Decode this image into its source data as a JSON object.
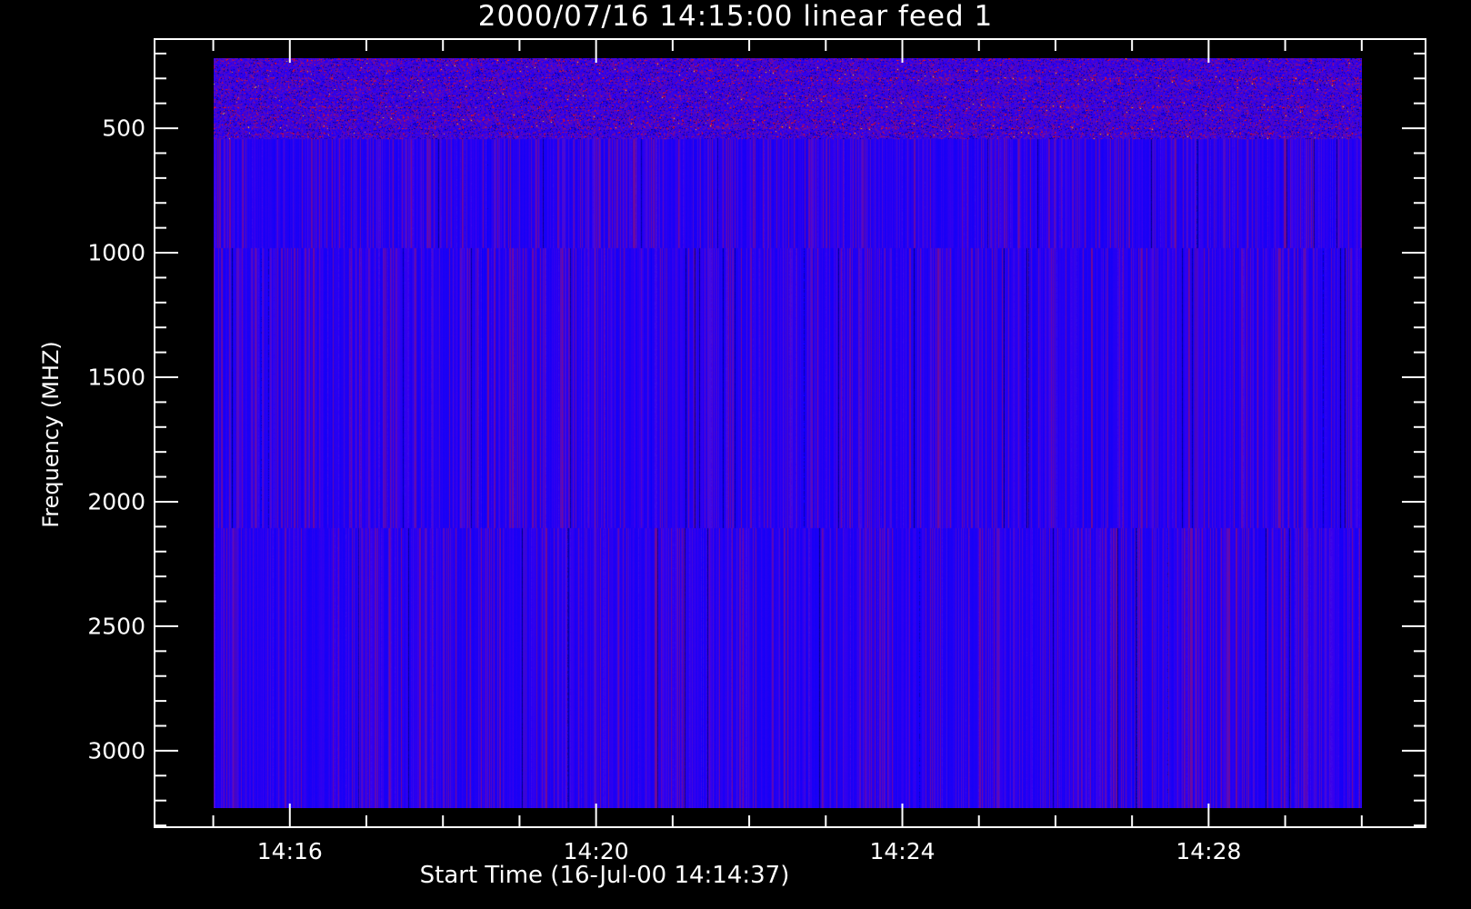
{
  "chart_data": {
    "type": "heatmap",
    "title": "2000/07/16 14:15:00 linear feed 1",
    "xlabel": "Start Time (16-Jul-00 14:14:37)",
    "ylabel": "Frequency (MHZ)",
    "x_unit": "minutes",
    "xlim": [
      "14:14:14",
      "14:30:50"
    ],
    "data_x_range": [
      "14:15:00",
      "14:30:00"
    ],
    "x_major_ticks": [
      {
        "minute": 16,
        "label": "14:16"
      },
      {
        "minute": 20,
        "label": "14:20"
      },
      {
        "minute": 24,
        "label": "14:24"
      },
      {
        "minute": 28,
        "label": "14:28"
      }
    ],
    "x_minor_tick_interval_min": 1,
    "ylim": [
      142,
      3307
    ],
    "y_inverted": true,
    "data_y_range": [
      220,
      3230
    ],
    "y_major_ticks": [
      {
        "value": 500,
        "label": "500"
      },
      {
        "value": 1000,
        "label": "1000"
      },
      {
        "value": 1500,
        "label": "1500"
      },
      {
        "value": 2000,
        "label": "2000"
      },
      {
        "value": 2500,
        "label": "2500"
      },
      {
        "value": 3000,
        "label": "3000"
      }
    ],
    "y_minor_tick_interval": 100,
    "colormap": [
      "#000000",
      "#0000ff",
      "#7a1090",
      "#ff0000",
      "#ffff00"
    ],
    "bands_mhz": [
      {
        "from": 220,
        "to": 545,
        "texture": "noisy"
      },
      {
        "from": 545,
        "to": 980,
        "texture": "stripes"
      },
      {
        "from": 980,
        "to": 2105,
        "texture": "stripes"
      },
      {
        "from": 2105,
        "to": 3230,
        "texture": "stripes"
      }
    ]
  }
}
